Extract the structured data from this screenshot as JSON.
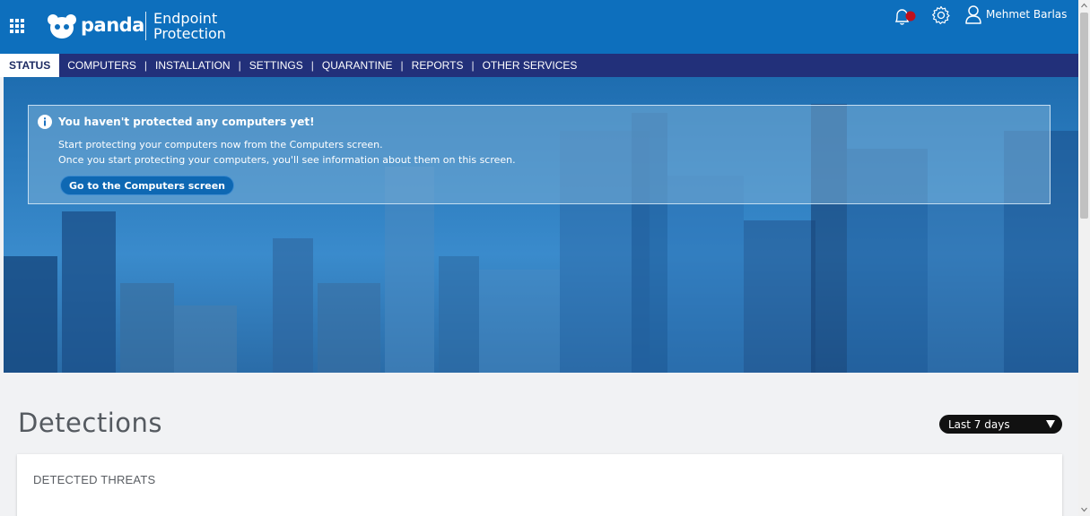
{
  "header": {
    "brand": "panda",
    "product_line1": "Endpoint",
    "product_line2": "Protection",
    "user_name": "Mehmet Barlas",
    "brand_color": "#0d6fbd",
    "notification_dot_color": "#c0101c"
  },
  "nav": {
    "items": [
      {
        "label": "STATUS",
        "active": true
      },
      {
        "label": "COMPUTERS"
      },
      {
        "label": "INSTALLATION"
      },
      {
        "label": "SETTINGS"
      },
      {
        "label": "QUARANTINE"
      },
      {
        "label": "REPORTS"
      },
      {
        "label": "OTHER SERVICES"
      }
    ],
    "separator": "|",
    "bar_color": "#22307a"
  },
  "notice": {
    "title": "You haven't protected any computers yet!",
    "line1": "Start protecting your computers now from the Computers screen.",
    "line2": "Once you start protecting your computers, you'll see information about them on this screen.",
    "button_label": "Go to the Computers screen"
  },
  "detections": {
    "title": "Detections",
    "period_selected": "Last 7 days",
    "card_title": "DETECTED THREATS"
  },
  "icons": {
    "apps": "apps-grid-icon",
    "logo": "panda-logo-icon",
    "notifications": "bell-icon",
    "settings": "gear-icon",
    "user": "user-icon",
    "info": "info-icon",
    "dropdown": "caret-down-icon"
  }
}
